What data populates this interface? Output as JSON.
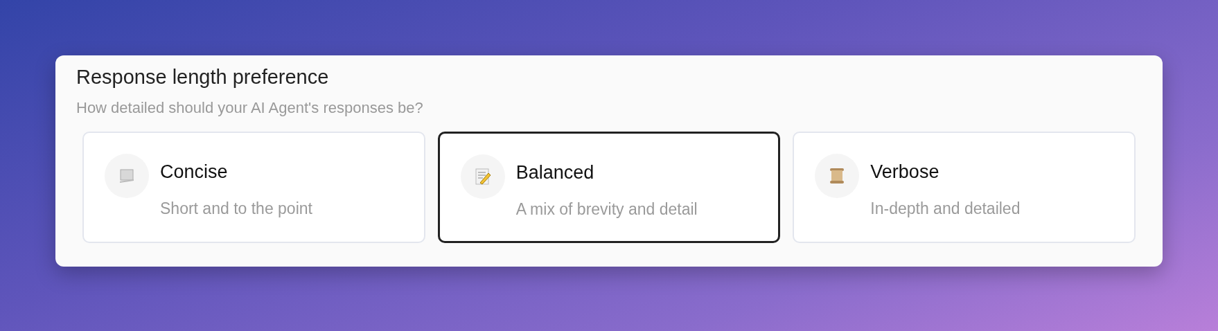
{
  "panel": {
    "title": "Response length preference",
    "subtitle": "How detailed should your AI Agent's responses be?"
  },
  "options": [
    {
      "label": "Concise",
      "description": "Short and to the point",
      "selected": false
    },
    {
      "label": "Balanced",
      "description": "A mix of brevity and detail",
      "selected": true
    },
    {
      "label": "Verbose",
      "description": "In-depth and detailed",
      "selected": false
    }
  ]
}
